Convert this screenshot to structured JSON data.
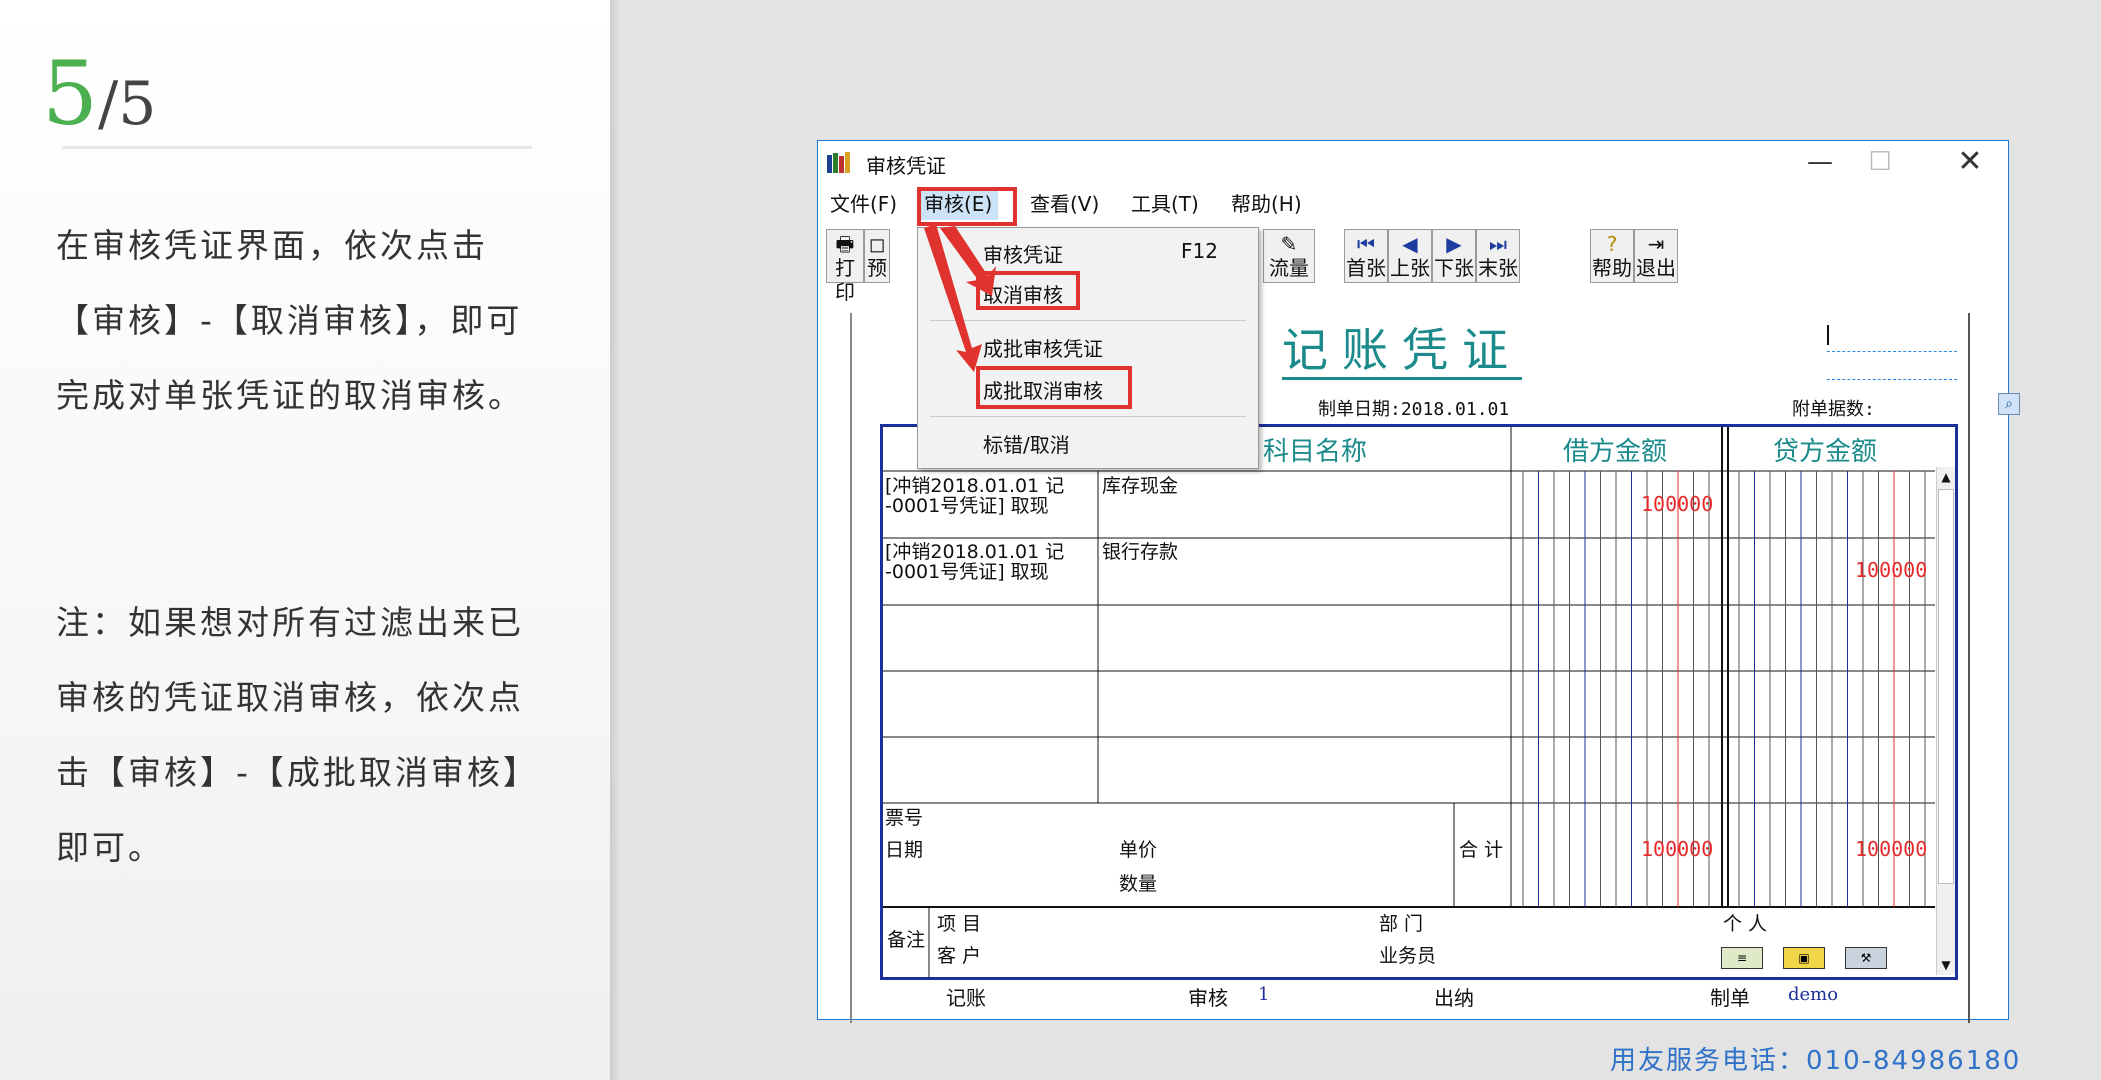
{
  "slide": {
    "step_current": "5",
    "step_total": "/5",
    "paragraph1": "在审核凭证界面，依次点击【审核】-【取消审核】，即可完成对单张凭证的取消审核。",
    "paragraph2": "注：如果想对所有过滤出来已审核的凭证取消审核，依次点击【审核】-【成批取消审核】即可。",
    "hotline": "用友服务电话：010-84986180",
    "accent_color": "#4caf50",
    "hotline_color": "#2f72c8",
    "highlight_color": "#e0322f"
  },
  "window": {
    "title": "审核凭证",
    "controls": {
      "minimize": "—",
      "maximize": "☐",
      "close": "✕"
    },
    "app_icon": "books-icon"
  },
  "menubar": {
    "file": "文件(F)",
    "audit": "审核(E)",
    "view": "查看(V)",
    "tools": "工具(T)",
    "help": "帮助(H)"
  },
  "toolbar": {
    "print": "打印",
    "preview": "预",
    "flow": "流量",
    "first": "首张",
    "prev": "上张",
    "next": "下张",
    "last": "末张",
    "help": "帮助",
    "exit": "退出",
    "icons": {
      "print": "🖶",
      "preview": "◻",
      "flow": "✎",
      "first": "⏮",
      "prev": "◀",
      "next": "▶",
      "last": "⏭",
      "help": "?",
      "exit": "⇥"
    }
  },
  "dropdown": {
    "audit_voucher": "审核凭证",
    "audit_voucher_key": "F12",
    "cancel_audit": "取消审核",
    "batch_audit": "成批审核凭证",
    "batch_cancel_audit": "成批取消审核",
    "mark_error": "标错/取消"
  },
  "voucher": {
    "title": "记账凭证",
    "date_label": "制单日期:2018.01.01",
    "attach_label": "附单据数:",
    "header_subject": "科目名称",
    "header_debit": "借方金额",
    "header_credit": "贷方金额",
    "rows": [
      {
        "summary_line1": "[冲销2018.01.01 记",
        "summary_line2": "-0001号凭证] 取现",
        "subject": "库存现金",
        "debit": "100000",
        "credit": ""
      },
      {
        "summary_line1": "[冲销2018.01.01 记",
        "summary_line2": "-0001号凭证] 取现",
        "subject": "银行存款",
        "debit": "",
        "credit": "100000"
      }
    ],
    "ticket_no": "票号",
    "date": "日期",
    "unit_price": "单价",
    "quantity": "数量",
    "total": "合 计",
    "total_debit": "100000",
    "total_credit": "100000",
    "remark": "备注",
    "project": "项 目",
    "customer": "客 户",
    "department": "部 门",
    "salesman": "业务员",
    "person": "个 人",
    "footer": {
      "bookkeeping": "记账",
      "audit": "审核",
      "audit_value": "1",
      "cashier": "出纳",
      "maker": "制单",
      "maker_value": "demo"
    }
  }
}
